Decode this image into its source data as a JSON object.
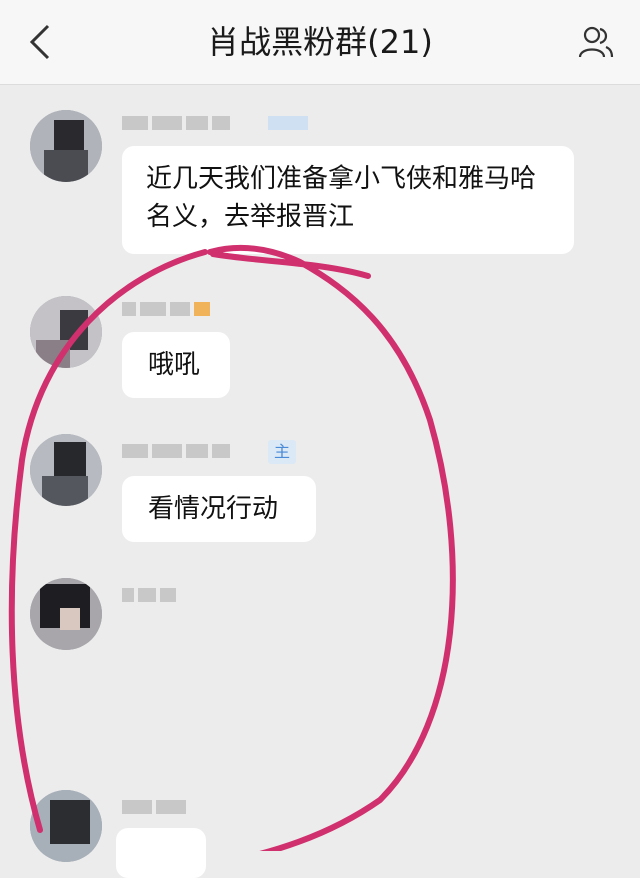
{
  "header": {
    "title": "肖战黑粉群(21)",
    "back_icon": "chevron-left-icon",
    "members_icon": "group-members-icon"
  },
  "messages": [
    {
      "text": "近几天我们准备拿小飞侠和雅马哈名义，去举报晋江"
    },
    {
      "text": "哦吼"
    },
    {
      "text": "看情况行动",
      "role_badge": "主"
    }
  ],
  "annotation": {
    "color": "#d0306e"
  }
}
